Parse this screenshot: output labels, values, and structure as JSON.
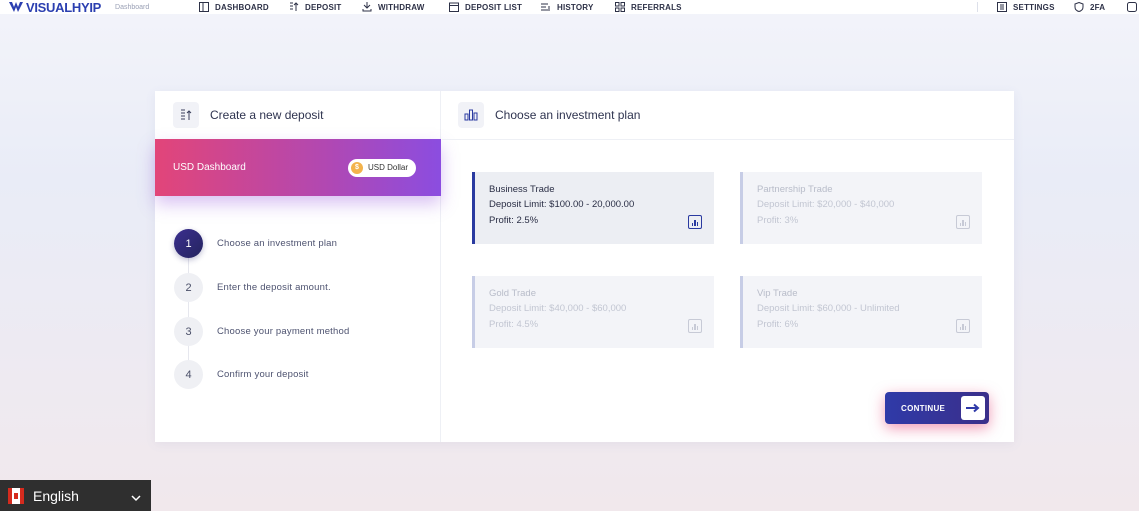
{
  "brand": {
    "name": "VISUALHYIP",
    "crumb": "Dashboard"
  },
  "nav": {
    "items": [
      {
        "label": "DASHBOARD",
        "icon": "dashboard-icon"
      },
      {
        "label": "DEPOSIT",
        "icon": "deposit-icon"
      },
      {
        "label": "WITHDRAW",
        "icon": "withdraw-icon"
      },
      {
        "label": "DEPOSIT LIST",
        "icon": "deposit-list-icon"
      },
      {
        "label": "HISTORY",
        "icon": "history-icon"
      },
      {
        "label": "REFERRALS",
        "icon": "referrals-icon"
      }
    ],
    "right": [
      {
        "label": "SETTINGS",
        "icon": "settings-icon"
      },
      {
        "label": "2FA",
        "icon": "shield-icon"
      }
    ]
  },
  "deposit": {
    "title": "Create a new deposit",
    "banner_title": "USD Dashboard",
    "currency_pill": "USD Dollar",
    "steps": [
      {
        "num": "1",
        "label": "Choose an investment plan",
        "active": true
      },
      {
        "num": "2",
        "label": "Enter the deposit amount.",
        "active": false
      },
      {
        "num": "3",
        "label": "Choose your payment method",
        "active": false
      },
      {
        "num": "4",
        "label": "Confirm your deposit",
        "active": false
      }
    ]
  },
  "plans": {
    "title": "Choose an investment plan",
    "items": [
      {
        "name": "Business Trade",
        "limit": "Deposit Limit: $100.00 - 20,000.00",
        "profit": "Profit: 2.5%",
        "selected": true
      },
      {
        "name": "Partnership Trade",
        "limit": "Deposit Limit: $20,000 - $40,000",
        "profit": "Profit: 3%",
        "selected": false
      },
      {
        "name": "Gold Trade",
        "limit": "Deposit Limit: $40,000 - $60,000",
        "profit": "Profit: 4.5%",
        "selected": false
      },
      {
        "name": "Vip Trade",
        "limit": "Deposit Limit: $60,000 - Unlimited",
        "profit": "Profit: 6%",
        "selected": false
      }
    ],
    "continue_label": "CONTINUE"
  },
  "language": {
    "current": "English"
  },
  "colors": {
    "accent": "#2a3aa0",
    "banner_start": "#e24579",
    "banner_end": "#8b4de0"
  }
}
